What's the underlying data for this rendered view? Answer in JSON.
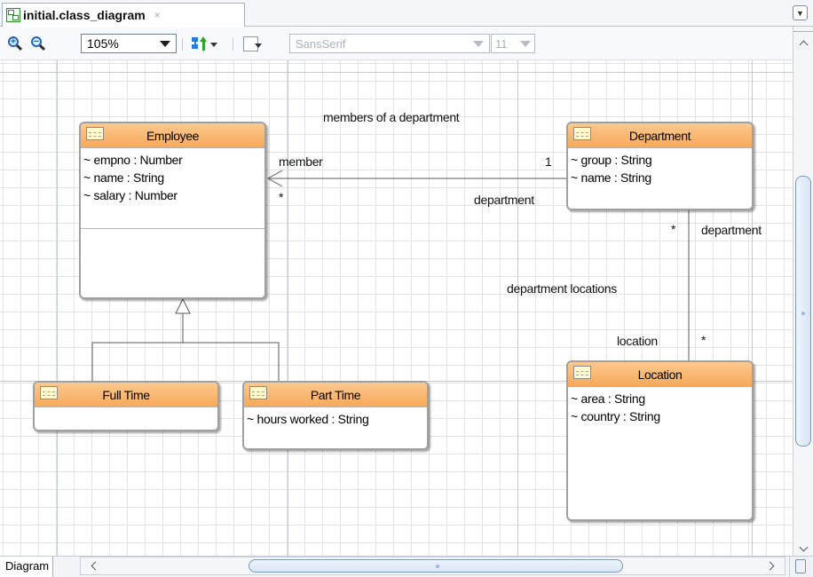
{
  "tab": {
    "title": "initial.class_diagram",
    "close": "×"
  },
  "toolbar": {
    "zoom_in": "+",
    "zoom_out": "−",
    "zoom_value": "105%",
    "font_family": "SansSerif",
    "font_size": "11"
  },
  "diagram": {
    "classes": {
      "employee": {
        "name": "Employee",
        "attributes": [
          "~ empno : Number",
          "~ name : String",
          "~ salary : Number"
        ]
      },
      "department": {
        "name": "Department",
        "attributes": [
          "~ group : String",
          "~ name : String"
        ]
      },
      "fulltime": {
        "name": "Full Time",
        "attributes": []
      },
      "parttime": {
        "name": "Part Time",
        "attributes": [
          "~ hours worked : String"
        ]
      },
      "location": {
        "name": "Location",
        "attributes": [
          "~ area : String",
          "~ country : String"
        ]
      }
    },
    "labels": {
      "members_of_department": "members of a department",
      "member": "member",
      "member_mult": "*",
      "department_mult_one": "1",
      "department_role": "department",
      "department_star": "*",
      "department_role_right": "department",
      "department_locations": "department locations",
      "location_role": "location",
      "location_mult": "*"
    }
  },
  "bottom": {
    "view_tab": "Diagram"
  }
}
